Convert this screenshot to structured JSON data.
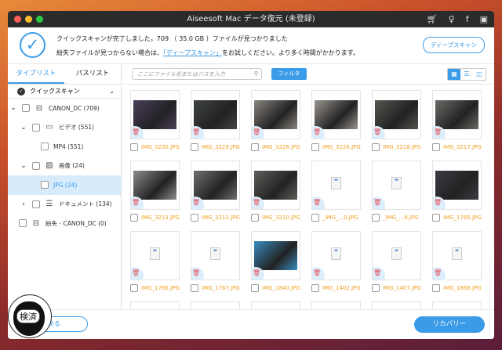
{
  "window": {
    "title": "Aiseesoft Mac データ復元 (未登録)"
  },
  "header": {
    "message1": "クイックスキャンが完了しました。709 （ 35.0 GB ）ファイルが見つかりました",
    "message2_prefix": "紛失ファイルが見つからない場合は、",
    "message2_link": "「ディープスキャン」",
    "message2_suffix": "をお試しください。より多く時間がかかります。",
    "deep_scan_button": "ディープスキャン"
  },
  "sidebar": {
    "tabs": [
      "タイプリスト",
      "パスリスト"
    ],
    "scan_mode": "クイックスキャン",
    "items": [
      {
        "label": "CANON_DC (709)"
      },
      {
        "label": "ビデオ (551)"
      },
      {
        "label": "MP4 (551)"
      },
      {
        "label": "画像 (24)"
      },
      {
        "label": "JPG (24)"
      },
      {
        "label": "ドキュメント (134)"
      },
      {
        "label": "紛失 - CANON_DC (0)"
      }
    ]
  },
  "toolbar": {
    "search_placeholder": "ここにファイル名またはパスを入力",
    "filter_button": "フィルタ"
  },
  "files": [
    {
      "name": "IMG_3230.JPG",
      "thumb": "photo",
      "color": "#4a3f5a"
    },
    {
      "name": "IMG_3229.JPG",
      "thumb": "photo",
      "color": "#3f4440"
    },
    {
      "name": "IMG_3228.JPG",
      "thumb": "photo",
      "color": "#8a8580"
    },
    {
      "name": "IMG_3226.JPG",
      "thumb": "photo",
      "color": "#9a9590"
    },
    {
      "name": "IMG_3218.JPG",
      "thumb": "photo",
      "color": "#555550"
    },
    {
      "name": "IMG_3217.JPG",
      "thumb": "photo",
      "color": "#6a6a66"
    },
    {
      "name": "IMG_3213.JPG",
      "thumb": "photo",
      "color": "#8c8c8c"
    },
    {
      "name": "IMG_3212.JPG",
      "thumb": "photo",
      "color": "#6f706c"
    },
    {
      "name": "IMG_3210.JPG",
      "thumb": "photo",
      "color": "#5f605c"
    },
    {
      "name": "_IMG_...0.JPG",
      "thumb": "doc"
    },
    {
      "name": "_IMG_...8.JPG",
      "thumb": "doc"
    },
    {
      "name": "IMG_1785.JPG",
      "thumb": "photo",
      "color": "#3a3c44"
    },
    {
      "name": "IMG_1786.JPG",
      "thumb": "doc"
    },
    {
      "name": "IMG_1787.JPG",
      "thumb": "doc"
    },
    {
      "name": "IMG_1840.JPG",
      "thumb": "photo",
      "color": "#3a8cc0"
    },
    {
      "name": "IMG_1402.JPG",
      "thumb": "doc"
    },
    {
      "name": "IMG_1407.JPG",
      "thumb": "doc"
    },
    {
      "name": "IMG_1866.JPG",
      "thumb": "doc"
    }
  ],
  "footer": {
    "back_button": "戻る",
    "recover_button": "リカバリー"
  },
  "stamp": {
    "text": "検済定"
  }
}
